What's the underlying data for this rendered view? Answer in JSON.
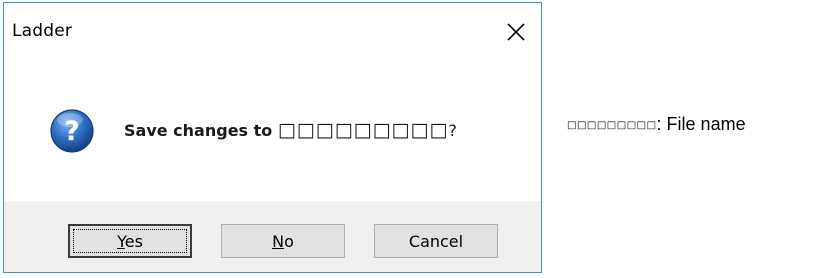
{
  "dialog": {
    "title": "Ladder",
    "close_icon": "close-icon",
    "message_prefix": "Save changes to ",
    "file_placeholder": "□□□□□□□□□",
    "message_suffix": "?",
    "icon": "question-icon",
    "buttons": {
      "yes_label": "Yes",
      "no_label": "No",
      "cancel_label": "Cancel"
    },
    "accent_color": "#3a8fd6",
    "footer_color": "#f0f0f0"
  },
  "note": {
    "placeholder": "□□□□□□□□□",
    "text": ": File name"
  }
}
